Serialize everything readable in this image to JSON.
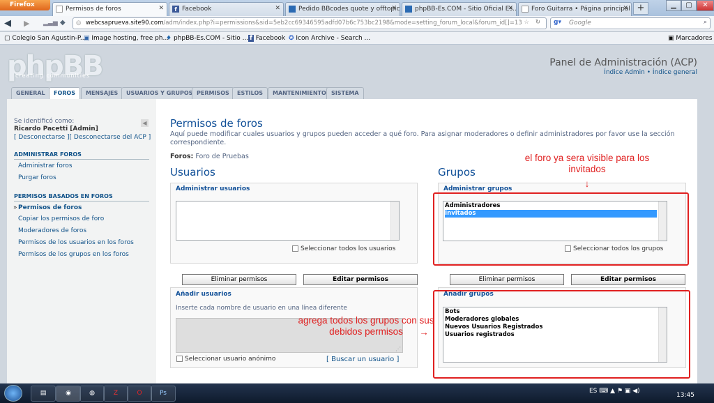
{
  "browser": {
    "menu_button": "Firefox",
    "tabs": [
      {
        "label": "Permisos de foros",
        "icon": "page-icon"
      },
      {
        "label": "Facebook",
        "icon": "facebook-icon"
      },
      {
        "label": "Pedido BBcodes quote y offtopic",
        "icon": "phpbb-icon"
      },
      {
        "label": "phpBB-Es.COM - Sitio Oficial Es...",
        "icon": "phpbb-icon"
      },
      {
        "label": "Foro Guitarra • Página principal",
        "icon": "page-icon"
      }
    ],
    "new_tab": "+",
    "url_host": "webcsaprueva.site90.com",
    "url_path": "/adm/index.php?i=permissions&sid=5eb2cc69346595adfd07b6c753bc2198&mode=setting_forum_local&forum_id[]=13",
    "search_placeholder": "Google",
    "bookmarks": [
      {
        "label": "Colegio San Agustin-P..."
      },
      {
        "label": "Image hosting, free ph..."
      },
      {
        "label": "phpBB-Es.COM - Sitio ..."
      },
      {
        "label": "Facebook"
      },
      {
        "label": "Icon Archive - Search ..."
      }
    ],
    "bookmarks_menu": "Marcadores"
  },
  "header": {
    "logo": "phpBB",
    "logo_sub": "creating communities",
    "acp_title": "Panel de Administración (ACP)",
    "link_index_admin": "Índice Admin",
    "separator": "•",
    "link_index_general": "Índice general"
  },
  "nav_tabs": [
    {
      "label": "GENERAL",
      "active": false
    },
    {
      "label": "FOROS",
      "active": true
    },
    {
      "label": "MENSAJES",
      "active": false
    },
    {
      "label": "USUARIOS Y GRUPOS",
      "active": false
    },
    {
      "label": "PERMISOS",
      "active": false
    },
    {
      "label": "ESTILOS",
      "active": false
    },
    {
      "label": "MANTENIMIENTO",
      "active": false
    },
    {
      "label": "SISTEMA",
      "active": false
    }
  ],
  "sidebar": {
    "identified_as": "Se identificó como:",
    "username": "Ricardo Pacetti [Admin]",
    "logout": "[ Desconectarse ][ Desconectarse del ACP ]",
    "section1": "ADMINISTRAR FOROS",
    "section1_items": [
      "Administrar foros",
      "Purgar foros"
    ],
    "section2": "PERMISOS BASADOS EN FOROS",
    "section2_items": [
      "Permisos de foros",
      "Copiar los permisos de foro",
      "Moderadores de foros",
      "Permisos de los usuarios en los foros",
      "Permisos de los grupos en los foros"
    ]
  },
  "content": {
    "title": "Permisos de foros",
    "description": "Aquí puede modificar cuales usuarios y grupos pueden acceder a qué foro. Para asignar moderadores o definir administradores por favor use la sección correspondiente.",
    "forums_label": "Foros:",
    "forums_value": "Foro de Pruebas",
    "users": {
      "heading": "Usuarios",
      "manage_legend": "Administrar usuarios",
      "select_all": "Seleccionar todos los usuarios",
      "remove_button": "Eliminar permisos",
      "edit_button": "Editar permisos",
      "add_legend": "Añadir usuarios",
      "add_hint": "Inserte cada nombre de usuario en una línea diferente",
      "anon_checkbox": "Seleccionar usuario anónimo",
      "find_user": "[ Buscar un usuario ]"
    },
    "groups": {
      "heading": "Grupos",
      "manage_legend": "Administrar grupos",
      "current_groups": [
        "Administradores",
        "Invitados"
      ],
      "selected_index": 1,
      "select_all": "Seleccionar todos los grupos",
      "remove_button": "Eliminar permisos",
      "edit_button": "Editar permisos",
      "add_legend": "Añadir grupos",
      "available_groups": [
        "Bots",
        "Moderadores globales",
        "Nuevos Usuarios Registrados",
        "Usuarios registrados"
      ]
    }
  },
  "annotations": {
    "top_note": "el foro ya sera visible para los invitados",
    "top_arrow": "↓",
    "bottom_note": "agrega todos los grupos con sus debidos permisos",
    "bottom_arrow": "→",
    "color": "#e02020"
  },
  "taskbar": {
    "apps": [
      "explorer",
      "firefox",
      "chrome",
      "filezilla",
      "opera",
      "photoshop"
    ],
    "language": "ES",
    "clock": "13:45"
  }
}
